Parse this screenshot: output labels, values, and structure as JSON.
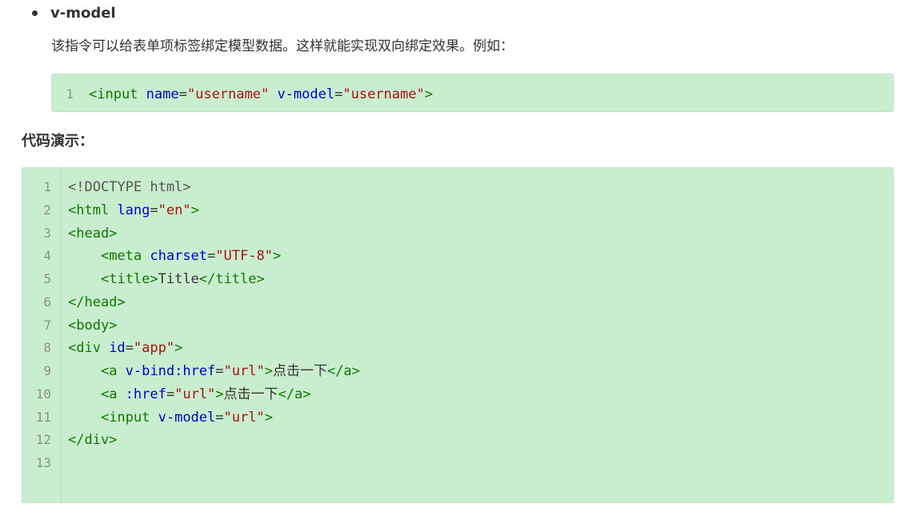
{
  "list_item": {
    "title": "v-model"
  },
  "description": "该指令可以给表单项标签绑定模型数据。这样就能实现双向绑定效果。例如：",
  "snippet": {
    "line_number": "1",
    "open": "<input",
    "attr1": " name",
    "eq1": "=",
    "val1": "\"username\"",
    "attr2": " v-model",
    "eq2": "=",
    "val2": "\"username\"",
    "close": ">"
  },
  "section_label": "代码演示：",
  "demo": {
    "line_numbers": [
      "1",
      "2",
      "3",
      "4",
      "5",
      "6",
      "7",
      "8",
      "9",
      "10",
      "11",
      "12",
      "13"
    ],
    "lines": [
      [
        {
          "t": "<!DOCTYPE html>",
          "c": "meta"
        }
      ],
      [
        {
          "t": "<html",
          "c": "tag"
        },
        {
          "t": " lang",
          "c": "attr"
        },
        {
          "t": "=",
          "c": "txt"
        },
        {
          "t": "\"en\"",
          "c": "str"
        },
        {
          "t": ">",
          "c": "tag"
        }
      ],
      [
        {
          "t": "<head>",
          "c": "tag"
        }
      ],
      [
        {
          "t": "    ",
          "c": "txt"
        },
        {
          "t": "<meta",
          "c": "tag"
        },
        {
          "t": " charset",
          "c": "attr"
        },
        {
          "t": "=",
          "c": "txt"
        },
        {
          "t": "\"UTF-8\"",
          "c": "str"
        },
        {
          "t": ">",
          "c": "tag"
        }
      ],
      [
        {
          "t": "    ",
          "c": "txt"
        },
        {
          "t": "<title>",
          "c": "tag"
        },
        {
          "t": "Title",
          "c": "txt"
        },
        {
          "t": "</title>",
          "c": "tag"
        }
      ],
      [
        {
          "t": "</head>",
          "c": "tag"
        }
      ],
      [
        {
          "t": "<body>",
          "c": "tag"
        }
      ],
      [
        {
          "t": "<div",
          "c": "tag"
        },
        {
          "t": " id",
          "c": "attr"
        },
        {
          "t": "=",
          "c": "txt"
        },
        {
          "t": "\"app\"",
          "c": "str"
        },
        {
          "t": ">",
          "c": "tag"
        }
      ],
      [
        {
          "t": "    ",
          "c": "txt"
        },
        {
          "t": "<a",
          "c": "tag"
        },
        {
          "t": " v-bind:href",
          "c": "attr"
        },
        {
          "t": "=",
          "c": "txt"
        },
        {
          "t": "\"url\"",
          "c": "str"
        },
        {
          "t": ">",
          "c": "tag"
        },
        {
          "t": "点击一下",
          "c": "txt"
        },
        {
          "t": "</a>",
          "c": "tag"
        }
      ],
      [
        {
          "t": "    ",
          "c": "txt"
        },
        {
          "t": "<a",
          "c": "tag"
        },
        {
          "t": " :href",
          "c": "attr"
        },
        {
          "t": "=",
          "c": "txt"
        },
        {
          "t": "\"url\"",
          "c": "str"
        },
        {
          "t": ">",
          "c": "tag"
        },
        {
          "t": "点击一下",
          "c": "txt"
        },
        {
          "t": "</a>",
          "c": "tag"
        }
      ],
      [
        {
          "t": "    ",
          "c": "txt"
        },
        {
          "t": "<input",
          "c": "tag"
        },
        {
          "t": " v-model",
          "c": "attr"
        },
        {
          "t": "=",
          "c": "txt"
        },
        {
          "t": "\"url\"",
          "c": "str"
        },
        {
          "t": ">",
          "c": "tag"
        }
      ],
      [
        {
          "t": "</div>",
          "c": "tag"
        }
      ],
      []
    ]
  },
  "colors": {
    "code_background": "#c8edcf",
    "tag": "#117700",
    "attribute": "#0000cc",
    "string": "#aa1111",
    "line_number": "#8f8f8f"
  }
}
